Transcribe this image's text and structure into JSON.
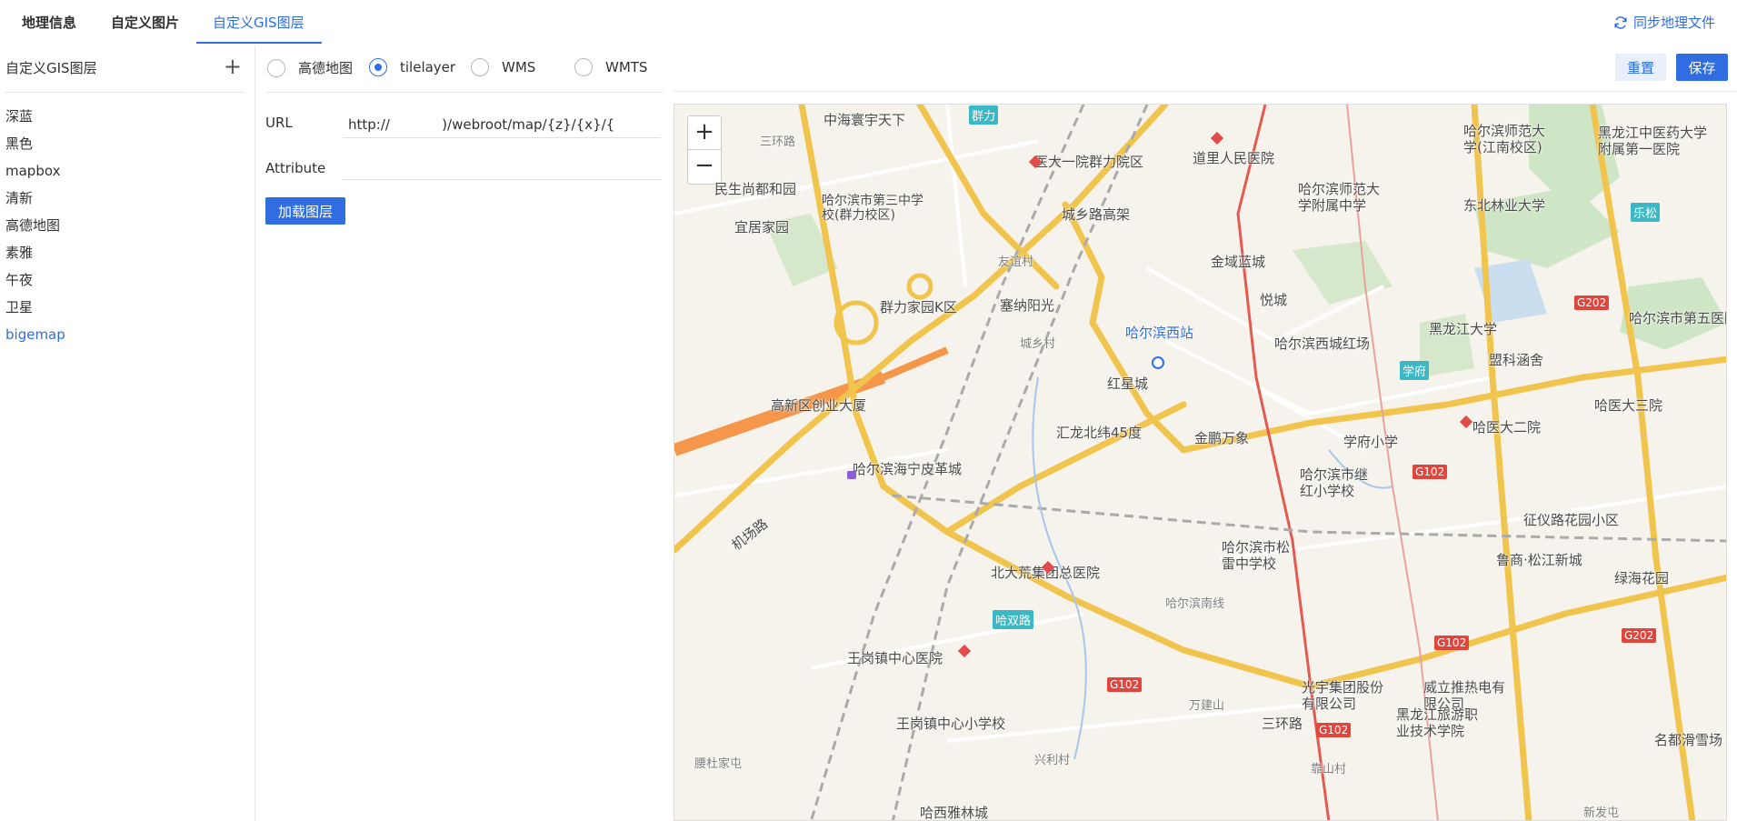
{
  "tabs": [
    {
      "label": "地理信息"
    },
    {
      "label": "自定义图片"
    },
    {
      "label": "自定义GIS图层"
    }
  ],
  "sync_label": "同步地理文件",
  "left_panel": {
    "title": "自定义GIS图层",
    "add_icon": "plus-icon",
    "items": [
      {
        "label": "深蓝"
      },
      {
        "label": "黑色"
      },
      {
        "label": "mapbox"
      },
      {
        "label": "清新"
      },
      {
        "label": "高德地图"
      },
      {
        "label": "素雅"
      },
      {
        "label": "午夜"
      },
      {
        "label": "卫星"
      },
      {
        "label": "bigemap"
      }
    ],
    "selected": "bigemap"
  },
  "layer_types": [
    {
      "label": "高德地图",
      "checked": false
    },
    {
      "label": "tilelayer",
      "checked": true
    },
    {
      "label": "WMS",
      "checked": false
    },
    {
      "label": "WMTS",
      "checked": false
    }
  ],
  "form": {
    "url_label": "URL",
    "url_value": "http://            )/webroot/map/{z}/{x}/{",
    "attribute_label": "Attribute",
    "attribute_value": "",
    "load_button": "加载图层"
  },
  "actions": {
    "reset": "重置",
    "save": "保存"
  },
  "map": {
    "zoom_in": "+",
    "zoom_out": "−",
    "labels": [
      "中海寰宇天下",
      "群力",
      "三环路",
      "民生尚都和园",
      "宜居家园",
      "哈尔滨市第三中学校(群力校区)",
      "医大一院群力院区",
      "城乡路高架",
      "道里人民医院",
      "哈尔滨师范大学附属中学",
      "哈尔滨师范大学(江南校区)",
      "黑龙江中医药大学附属第一医院",
      "东北林业大学",
      "乐松",
      "金域蓝城",
      "友谊村",
      "悦城",
      "黑龙江大学",
      "哈尔滨市第五医院",
      "群力家园K区",
      "塞纳阳光",
      "哈尔滨西站",
      "哈尔滨西城红场",
      "城乡村",
      "盟科涵舍",
      "学府",
      "红星城",
      "高新区创业大厦",
      "汇龙北纬45度",
      "金鹏万象",
      "学府小学",
      "哈医大二院",
      "哈医大三院",
      "哈尔滨海宁皮革城",
      "哈尔滨市继红小学校",
      "征仪路花园小区",
      "机场路",
      "哈尔滨市松雷中学校",
      "鲁商·松江新城",
      "绿海花园",
      "北大荒集团总医院",
      "哈双路",
      "王岗镇中心医院",
      "王岗镇中心小学校",
      "万建山",
      "三环路",
      "光宇集团股份有限公司",
      "威立推热电有限公司",
      "黑龙江旅游职业技术学院",
      "名都滑雪场",
      "腰杜家屯",
      "兴利村",
      "靠山村",
      "新发屯",
      "哈西雅林城",
      "哈尔滨南线",
      "G102",
      "G202"
    ]
  },
  "colors": {
    "accent": "#2f6de1",
    "map_bg": "#f6f3ec",
    "road_yellow": "#f1c44d",
    "road_orange": "#f5964a",
    "rail_red": "#e35b50"
  }
}
